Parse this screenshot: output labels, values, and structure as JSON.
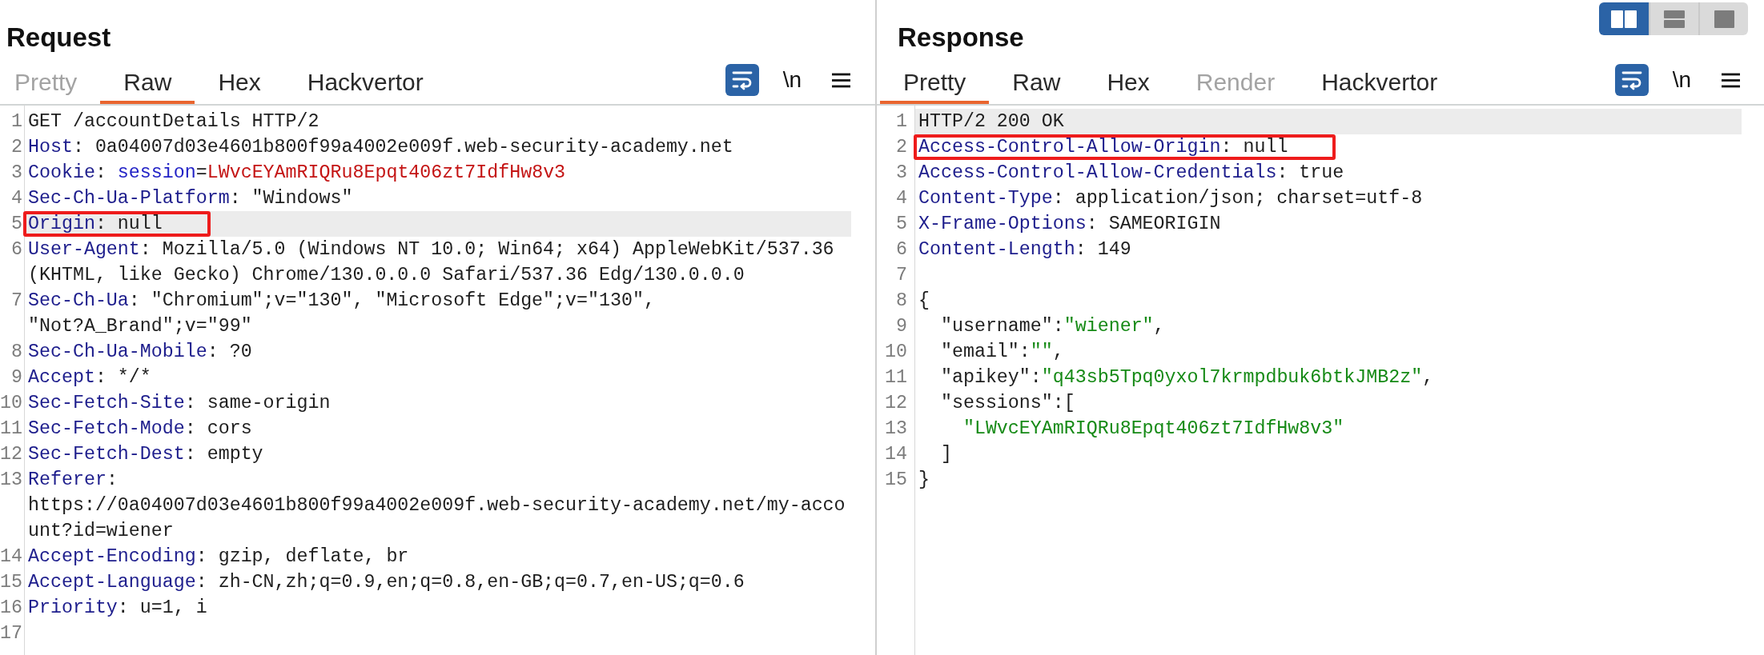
{
  "layout_toggle": [
    {
      "kind": "columns",
      "selected": true
    },
    {
      "kind": "rows",
      "selected": false
    },
    {
      "kind": "single",
      "selected": false
    }
  ],
  "request": {
    "title": "Request",
    "tabs": [
      {
        "label": "Pretty",
        "selected": false,
        "disabled": true
      },
      {
        "label": "Raw",
        "selected": true,
        "disabled": false
      },
      {
        "label": "Hex",
        "selected": false,
        "disabled": false
      },
      {
        "label": "Hackvertor",
        "selected": false,
        "disabled": false
      }
    ],
    "toolbar": [
      {
        "kind": "wrap",
        "on": true
      },
      {
        "kind": "text",
        "label": "\\n"
      },
      {
        "kind": "menu"
      }
    ],
    "lines": [
      {
        "number": "1",
        "highlighted": false,
        "boxed": false,
        "segments": [
          {
            "kind": "plain",
            "text": "GET /accountDetails HTTP/2"
          }
        ]
      },
      {
        "number": "2",
        "highlighted": false,
        "boxed": false,
        "segments": [
          {
            "kind": "name",
            "text": "Host"
          },
          {
            "kind": "plain",
            "text": ": 0a04007d03e4601b800f99a4002e009f.web-security-academy.net"
          }
        ]
      },
      {
        "number": "3",
        "highlighted": false,
        "boxed": false,
        "segments": [
          {
            "kind": "name",
            "text": "Cookie"
          },
          {
            "kind": "plain",
            "text": ": "
          },
          {
            "kind": "param",
            "text": "session"
          },
          {
            "kind": "plain",
            "text": "="
          },
          {
            "kind": "cookie",
            "text": "LWvcEYAmRIQRu8Epqt406zt7IdfHw8v3"
          }
        ]
      },
      {
        "number": "4",
        "highlighted": false,
        "boxed": false,
        "segments": [
          {
            "kind": "name",
            "text": "Sec-Ch-Ua-Platform"
          },
          {
            "kind": "plain",
            "text": ": \"Windows\""
          }
        ]
      },
      {
        "number": "5",
        "highlighted": true,
        "boxed": true,
        "segments": [
          {
            "kind": "name",
            "text": "Origin"
          },
          {
            "kind": "plain",
            "text": ": null"
          }
        ]
      },
      {
        "number": "6",
        "highlighted": false,
        "boxed": false,
        "segments": [
          {
            "kind": "name",
            "text": "User-Agent"
          },
          {
            "kind": "plain",
            "text": ": Mozilla/5.0 (Windows NT 10.0; Win64; x64) AppleWebKit/537.36"
          },
          {
            "kind": "wrap"
          },
          {
            "kind": "plain",
            "text": "(KHTML, like Gecko) Chrome/130.0.0.0 Safari/537.36 Edg/130.0.0.0"
          }
        ]
      },
      {
        "number": "7",
        "highlighted": false,
        "boxed": false,
        "segments": [
          {
            "kind": "name",
            "text": "Sec-Ch-Ua"
          },
          {
            "kind": "plain",
            "text": ": \"Chromium\";v=\"130\", \"Microsoft Edge\";v=\"130\","
          },
          {
            "kind": "wrap"
          },
          {
            "kind": "plain",
            "text": "\"Not?A_Brand\";v=\"99\""
          }
        ]
      },
      {
        "number": "8",
        "highlighted": false,
        "boxed": false,
        "segments": [
          {
            "kind": "name",
            "text": "Sec-Ch-Ua-Mobile"
          },
          {
            "kind": "plain",
            "text": ": ?0"
          }
        ]
      },
      {
        "number": "9",
        "highlighted": false,
        "boxed": false,
        "segments": [
          {
            "kind": "name",
            "text": "Accept"
          },
          {
            "kind": "plain",
            "text": ": */*"
          }
        ]
      },
      {
        "number": "10",
        "highlighted": false,
        "boxed": false,
        "segments": [
          {
            "kind": "name",
            "text": "Sec-Fetch-Site"
          },
          {
            "kind": "plain",
            "text": ": same-origin"
          }
        ]
      },
      {
        "number": "11",
        "highlighted": false,
        "boxed": false,
        "segments": [
          {
            "kind": "name",
            "text": "Sec-Fetch-Mode"
          },
          {
            "kind": "plain",
            "text": ": cors"
          }
        ]
      },
      {
        "number": "12",
        "highlighted": false,
        "boxed": false,
        "segments": [
          {
            "kind": "name",
            "text": "Sec-Fetch-Dest"
          },
          {
            "kind": "plain",
            "text": ": empty"
          }
        ]
      },
      {
        "number": "13",
        "highlighted": false,
        "boxed": false,
        "segments": [
          {
            "kind": "name",
            "text": "Referer"
          },
          {
            "kind": "plain",
            "text": ":"
          },
          {
            "kind": "wrap"
          },
          {
            "kind": "plain",
            "text": "https://0a04007d03e4601b800f99a4002e009f.web-security-academy.net/my-acco"
          },
          {
            "kind": "wrap"
          },
          {
            "kind": "plain",
            "text": "unt?id=wiener"
          }
        ]
      },
      {
        "number": "14",
        "highlighted": false,
        "boxed": false,
        "segments": [
          {
            "kind": "name",
            "text": "Accept-Encoding"
          },
          {
            "kind": "plain",
            "text": ": gzip, deflate, br"
          }
        ]
      },
      {
        "number": "15",
        "highlighted": false,
        "boxed": false,
        "segments": [
          {
            "kind": "name",
            "text": "Accept-Language"
          },
          {
            "kind": "plain",
            "text": ": zh-CN,zh;q=0.9,en;q=0.8,en-GB;q=0.7,en-US;q=0.6"
          }
        ]
      },
      {
        "number": "16",
        "highlighted": false,
        "boxed": false,
        "segments": [
          {
            "kind": "name",
            "text": "Priority"
          },
          {
            "kind": "plain",
            "text": ": u=1, i"
          }
        ]
      },
      {
        "number": "17",
        "highlighted": false,
        "boxed": false
      }
    ]
  },
  "response": {
    "title": "Response",
    "tabs": [
      {
        "label": "Pretty",
        "selected": true,
        "disabled": false
      },
      {
        "label": "Raw",
        "selected": false,
        "disabled": false
      },
      {
        "label": "Hex",
        "selected": false,
        "disabled": false
      },
      {
        "label": "Render",
        "selected": false,
        "disabled": true
      },
      {
        "label": "Hackvertor",
        "selected": false,
        "disabled": false
      }
    ],
    "toolbar": [
      {
        "kind": "wrap",
        "on": true
      },
      {
        "kind": "text",
        "label": "\\n"
      },
      {
        "kind": "menu"
      }
    ],
    "lines": [
      {
        "number": "1",
        "highlighted": true,
        "boxed": false,
        "segments": [
          {
            "kind": "plain",
            "text": "HTTP/2 200 OK"
          }
        ]
      },
      {
        "number": "2",
        "highlighted": false,
        "boxed": true,
        "segments": [
          {
            "kind": "name",
            "text": "Access-Control-Allow-Origin"
          },
          {
            "kind": "plain",
            "text": ": null"
          }
        ]
      },
      {
        "number": "3",
        "highlighted": false,
        "boxed": false,
        "segments": [
          {
            "kind": "name",
            "text": "Access-Control-Allow-Credentials"
          },
          {
            "kind": "plain",
            "text": ": true"
          }
        ]
      },
      {
        "number": "4",
        "highlighted": false,
        "boxed": false,
        "segments": [
          {
            "kind": "name",
            "text": "Content-Type"
          },
          {
            "kind": "plain",
            "text": ": application/json; charset=utf-8"
          }
        ]
      },
      {
        "number": "5",
        "highlighted": false,
        "boxed": false,
        "segments": [
          {
            "kind": "name",
            "text": "X-Frame-Options"
          },
          {
            "kind": "plain",
            "text": ": SAMEORIGIN"
          }
        ]
      },
      {
        "number": "6",
        "highlighted": false,
        "boxed": false,
        "segments": [
          {
            "kind": "name",
            "text": "Content-Length"
          },
          {
            "kind": "plain",
            "text": ": 149"
          }
        ]
      },
      {
        "number": "7",
        "highlighted": false,
        "boxed": false
      },
      {
        "number": "8",
        "highlighted": false,
        "boxed": false,
        "segments": [
          {
            "kind": "plain",
            "text": "{"
          }
        ]
      },
      {
        "number": "9",
        "highlighted": false,
        "boxed": false,
        "segments": [
          {
            "kind": "plain",
            "text": "  \"username\":"
          },
          {
            "kind": "string",
            "text": "\"wiener\""
          },
          {
            "kind": "plain",
            "text": ","
          }
        ]
      },
      {
        "number": "10",
        "highlighted": false,
        "boxed": false,
        "segments": [
          {
            "kind": "plain",
            "text": "  \"email\":"
          },
          {
            "kind": "string",
            "text": "\"\""
          },
          {
            "kind": "plain",
            "text": ","
          }
        ]
      },
      {
        "number": "11",
        "highlighted": false,
        "boxed": false,
        "segments": [
          {
            "kind": "plain",
            "text": "  \"apikey\":"
          },
          {
            "kind": "string",
            "text": "\"q43sb5Tpq0yxol7krmpdbuk6btkJMB2z\""
          },
          {
            "kind": "plain",
            "text": ","
          }
        ]
      },
      {
        "number": "12",
        "highlighted": false,
        "boxed": false,
        "segments": [
          {
            "kind": "plain",
            "text": "  \"sessions\":["
          }
        ]
      },
      {
        "number": "13",
        "highlighted": false,
        "boxed": false,
        "segments": [
          {
            "kind": "string",
            "text": "    \"LWvcEYAmRIQRu8Epqt406zt7IdfHw8v3\""
          }
        ]
      },
      {
        "number": "14",
        "highlighted": false,
        "boxed": false,
        "segments": [
          {
            "kind": "plain",
            "text": "  ]"
          }
        ]
      },
      {
        "number": "15",
        "highlighted": false,
        "boxed": false,
        "segments": [
          {
            "kind": "plain",
            "text": "}"
          }
        ]
      }
    ]
  }
}
